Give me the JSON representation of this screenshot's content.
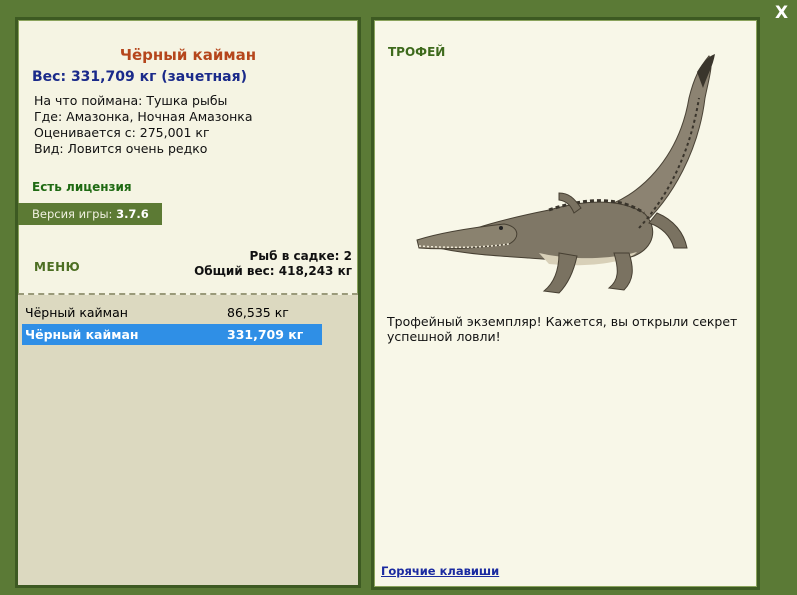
{
  "fish": {
    "name": "Чёрный кайман",
    "weight_line": "Вес: 331,709 кг (зачетная)",
    "caught_on": "На что поймана: Тушка рыбы",
    "location": "Где: Амазонка, Ночная Амазонка",
    "value": "Оценивается с: 275,001 кг",
    "rarity": "Вид: Ловится очень редко"
  },
  "license": "Есть лицензия",
  "version": {
    "label": "Версия игры:",
    "value": "3.7.6"
  },
  "menu_label": "МЕНЮ",
  "keepnet": {
    "count_line": "Рыб в садке: 2",
    "total_line": "Общий вес: 418,243 кг"
  },
  "list": [
    {
      "name": "Чёрный кайман",
      "weight": "86,535 кг"
    },
    {
      "name": "Чёрный кайман",
      "weight": "331,709 кг"
    }
  ],
  "trophy": {
    "label": "ТРОФЕЙ",
    "description": "Трофейный экземпляр! Кажется, вы открыли секрет успешной ловли!"
  },
  "hotkeys_link": "Горячие клавиши",
  "close_label": "X",
  "colors": {
    "background": "#5b7a36",
    "selected_row": "#2f8fe6",
    "title": "#b5461c",
    "weight": "#1a2a8a"
  }
}
